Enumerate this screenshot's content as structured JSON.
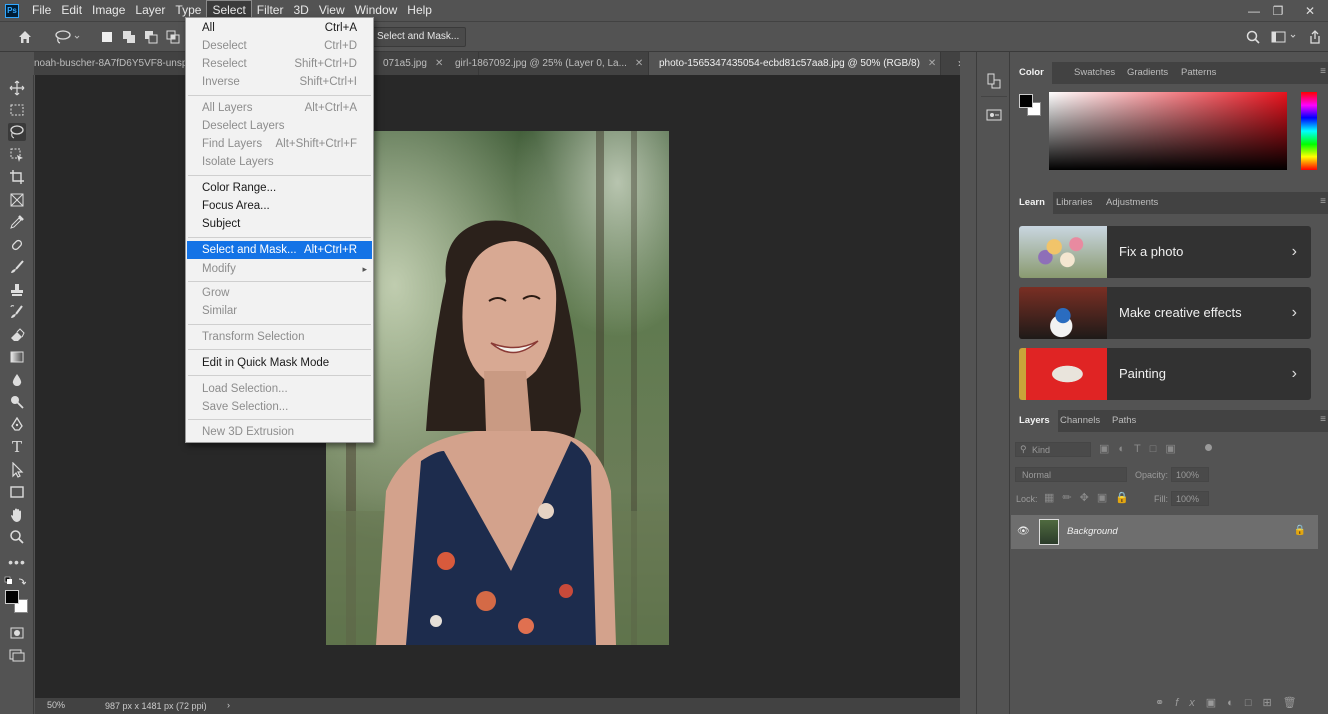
{
  "menubar": {
    "logo": "Ps",
    "items": [
      "File",
      "Edit",
      "Image",
      "Layer",
      "Type",
      "Select",
      "Filter",
      "3D",
      "View",
      "Window",
      "Help"
    ],
    "active": "Select"
  },
  "options_bar": {
    "select_and_mask_label": "Select and Mask..."
  },
  "tabs": [
    {
      "label": "noah-buscher-8A7fD6Y5VF8-unsp"
    },
    {
      "label": "071a5.jpg"
    },
    {
      "label": "girl-1867092.jpg @ 25% (Layer 0, La..."
    },
    {
      "label": "photo-1565347435054-ecbd81c57aa8.jpg @ 50% (RGB/8)"
    }
  ],
  "select_menu": {
    "items": [
      {
        "label": "All",
        "shortcut": "Ctrl+A",
        "disabled": false
      },
      {
        "label": "Deselect",
        "shortcut": "Ctrl+D",
        "disabled": true
      },
      {
        "label": "Reselect",
        "shortcut": "Shift+Ctrl+D",
        "disabled": true
      },
      {
        "label": "Inverse",
        "shortcut": "Shift+Ctrl+I",
        "disabled": true
      },
      {
        "label": "All Layers",
        "shortcut": "Alt+Ctrl+A",
        "disabled": true
      },
      {
        "label": "Deselect Layers",
        "shortcut": "",
        "disabled": true
      },
      {
        "label": "Find Layers",
        "shortcut": "Alt+Shift+Ctrl+F",
        "disabled": true
      },
      {
        "label": "Isolate Layers",
        "shortcut": "",
        "disabled": true
      },
      {
        "label": "Color Range...",
        "shortcut": "",
        "disabled": false
      },
      {
        "label": "Focus Area...",
        "shortcut": "",
        "disabled": false
      },
      {
        "label": "Subject",
        "shortcut": "",
        "disabled": false
      },
      {
        "label": "Select and Mask...",
        "shortcut": "Alt+Ctrl+R",
        "disabled": false,
        "highlighted": true
      },
      {
        "label": "Modify",
        "shortcut": "",
        "disabled": true,
        "submenu": true
      },
      {
        "label": "Grow",
        "shortcut": "",
        "disabled": true
      },
      {
        "label": "Similar",
        "shortcut": "",
        "disabled": true
      },
      {
        "label": "Transform Selection",
        "shortcut": "",
        "disabled": true
      },
      {
        "label": "Edit in Quick Mask Mode",
        "shortcut": "",
        "disabled": false
      },
      {
        "label": "Load Selection...",
        "shortcut": "",
        "disabled": true
      },
      {
        "label": "Save Selection...",
        "shortcut": "",
        "disabled": true
      },
      {
        "label": "New 3D Extrusion",
        "shortcut": "",
        "disabled": true
      }
    ],
    "submenu_arrow": "▸"
  },
  "status": {
    "zoom": "50%",
    "doc_info": "987 px x 1481 px (72 ppi)",
    "arrow": "›"
  },
  "color_panel": {
    "tabs": [
      "Color",
      "Swatches",
      "Gradients",
      "Patterns"
    ],
    "active": "Color"
  },
  "learn_panel": {
    "tabs": [
      "Learn",
      "Libraries",
      "Adjustments"
    ],
    "active": "Learn",
    "cards": [
      {
        "label": "Fix a photo"
      },
      {
        "label": "Make creative effects"
      },
      {
        "label": "Painting"
      }
    ],
    "arrow": "›"
  },
  "layers_panel": {
    "tabs": [
      "Layers",
      "Channels",
      "Paths"
    ],
    "active": "Layers",
    "kind_placeholder": "Kind",
    "blend_mode": "Normal",
    "opacity_label": "Opacity:",
    "opacity_value": "100%",
    "lock_label": "Lock:",
    "fill_label": "Fill:",
    "fill_value": "100%",
    "layer_name": "Background"
  },
  "colors": {
    "highlight": "#1473e6",
    "accent_blue": "#31a8ff"
  }
}
